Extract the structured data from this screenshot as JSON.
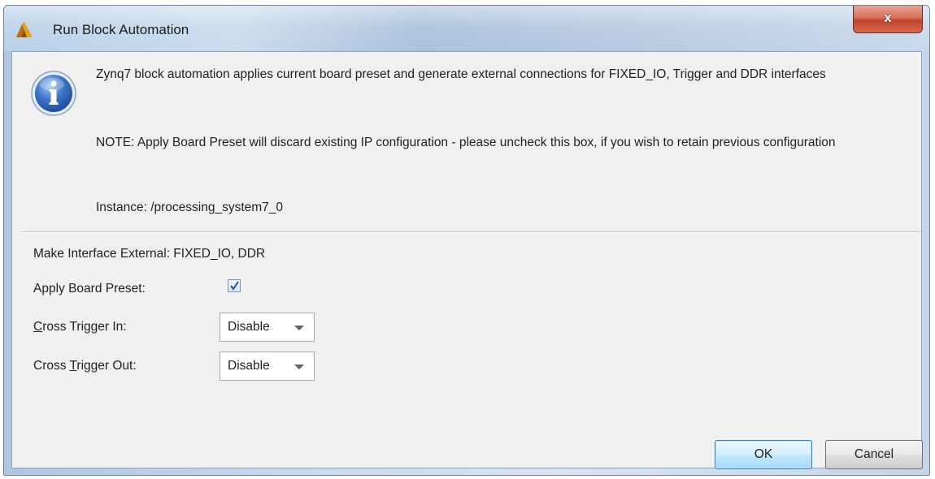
{
  "window": {
    "title": "Run Block Automation",
    "close_label": "x"
  },
  "info": {
    "message": "Zynq7 block automation applies current board preset and generate external connections for FIXED_IO, Trigger and DDR interfaces",
    "note": "NOTE: Apply Board Preset will discard existing IP configuration - please uncheck this box, if you wish to retain previous configuration",
    "instance": "Instance: /processing_system7_0"
  },
  "options": {
    "make_external": "Make Interface External: FIXED_IO, DDR",
    "apply_board_preset": {
      "label": "Apply Board Preset:",
      "checked": true
    },
    "cross_trigger_in": {
      "label_mnemonic": "C",
      "label_rest": "ross Trigger In:",
      "value": "Disable"
    },
    "cross_trigger_out": {
      "label_pre": "Cross ",
      "label_mnemonic": "T",
      "label_rest": "rigger Out:",
      "value": "Disable"
    }
  },
  "buttons": {
    "ok": "OK",
    "cancel": "Cancel"
  },
  "colors": {
    "info_icon": "#2f63b8",
    "checkmark": "#2b4f9b",
    "close_button": "#c2432b"
  },
  "icons": {
    "app": "vivado-logo-icon",
    "info": "info-icon",
    "dropdown": "chevron-down-icon"
  }
}
